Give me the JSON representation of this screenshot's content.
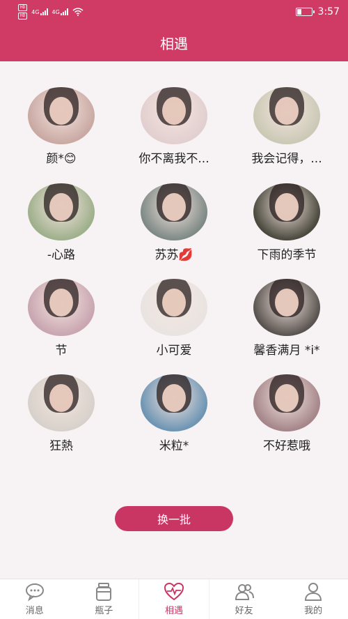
{
  "status_bar": {
    "hd1": "HD",
    "hd2": "HD",
    "net1": "4G",
    "net2": "4G",
    "time": "3:57",
    "battery_level": 0.3
  },
  "header": {
    "title": "相遇"
  },
  "people": [
    {
      "name": "颜*😊",
      "avatar_color": "#caa9a3"
    },
    {
      "name": "你不离我不...",
      "avatar_color": "#e2cfd0"
    },
    {
      "name": "我会记得，...",
      "avatar_color": "#cbc9b6"
    },
    {
      "name": "-心路",
      "avatar_color": "#9fb08c"
    },
    {
      "name": "苏苏💋",
      "avatar_color": "#7f8a86"
    },
    {
      "name": "下雨的季节",
      "avatar_color": "#4b4a3f"
    },
    {
      "name": "节",
      "avatar_color": "#c9a6b1"
    },
    {
      "name": "小可爱",
      "avatar_color": "#e9e4e1"
    },
    {
      "name": "馨香满月 *i*",
      "avatar_color": "#5a5450"
    },
    {
      "name": "狂熱",
      "avatar_color": "#d8d1cb"
    },
    {
      "name": "米粒*",
      "avatar_color": "#6e95b4"
    },
    {
      "name": "不好惹哦",
      "avatar_color": "#a5868a"
    }
  ],
  "refresh_button": {
    "label": "换一批"
  },
  "bottom_nav": [
    {
      "label": "消息",
      "icon": "chat-bubble-icon",
      "active": false
    },
    {
      "label": "瓶子",
      "icon": "bottle-icon",
      "active": false
    },
    {
      "label": "相遇",
      "icon": "heart-pulse-icon",
      "active": true
    },
    {
      "label": "好友",
      "icon": "friends-icon",
      "active": false
    },
    {
      "label": "我的",
      "icon": "profile-icon",
      "active": false
    }
  ],
  "colors": {
    "primary": "#d03b66",
    "accent": "#c93664"
  }
}
